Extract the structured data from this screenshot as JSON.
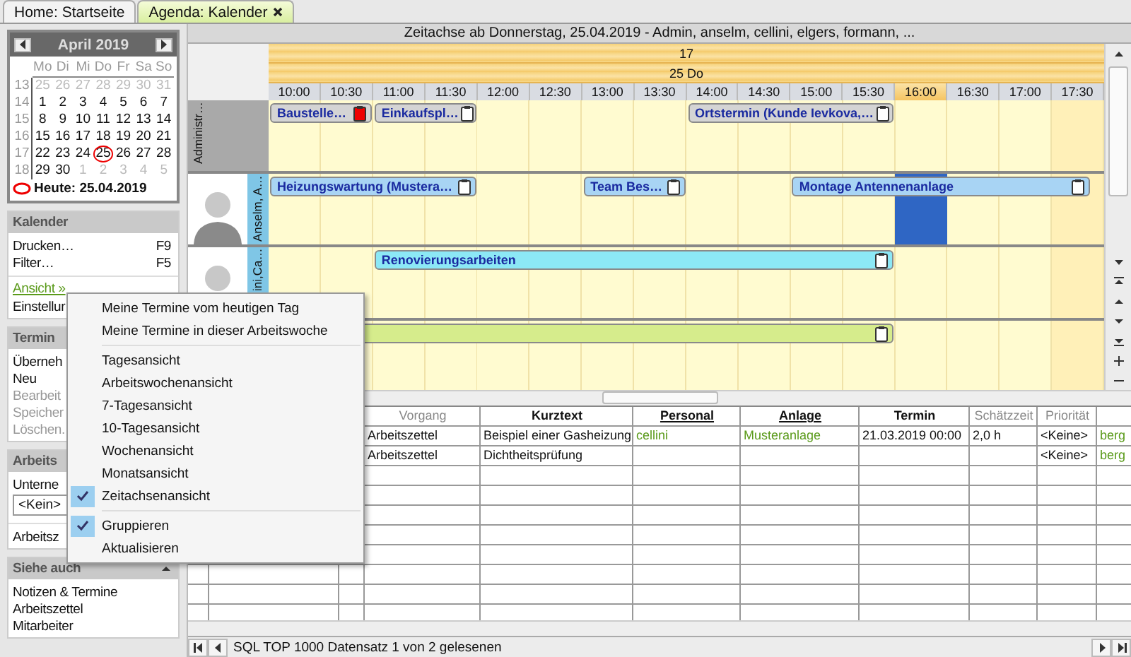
{
  "tabs": [
    {
      "label": "Home: Startseite",
      "selected": false,
      "closable": false
    },
    {
      "label": "Agenda: Kalender",
      "selected": true,
      "closable": true
    }
  ],
  "calendar": {
    "month": "April 2019",
    "weekdays": [
      "Mo",
      "Di",
      "Mi",
      "Do",
      "Fr",
      "Sa",
      "So"
    ],
    "weeks": [
      {
        "number": "13",
        "days": [
          {
            "label": "25",
            "muted": true,
            "today": false
          },
          {
            "label": "26",
            "muted": true,
            "today": false
          },
          {
            "label": "27",
            "muted": true,
            "today": false
          },
          {
            "label": "28",
            "muted": true,
            "today": false
          },
          {
            "label": "29",
            "muted": true,
            "today": false
          },
          {
            "label": "30",
            "muted": true,
            "today": false
          },
          {
            "label": "31",
            "muted": true,
            "today": false
          }
        ]
      },
      {
        "number": "14",
        "days": [
          {
            "label": "1",
            "muted": false,
            "today": false
          },
          {
            "label": "2",
            "muted": false,
            "today": false
          },
          {
            "label": "3",
            "muted": false,
            "today": false
          },
          {
            "label": "4",
            "muted": false,
            "today": false
          },
          {
            "label": "5",
            "muted": false,
            "today": false
          },
          {
            "label": "6",
            "muted": false,
            "today": false
          },
          {
            "label": "7",
            "muted": false,
            "today": false
          }
        ]
      },
      {
        "number": "15",
        "days": [
          {
            "label": "8",
            "muted": false,
            "today": false
          },
          {
            "label": "9",
            "muted": false,
            "today": false
          },
          {
            "label": "10",
            "muted": false,
            "today": false
          },
          {
            "label": "11",
            "muted": false,
            "today": false
          },
          {
            "label": "12",
            "muted": false,
            "today": false
          },
          {
            "label": "13",
            "muted": false,
            "today": false
          },
          {
            "label": "14",
            "muted": false,
            "today": false
          }
        ]
      },
      {
        "number": "16",
        "days": [
          {
            "label": "15",
            "muted": false,
            "today": false
          },
          {
            "label": "16",
            "muted": false,
            "today": false
          },
          {
            "label": "17",
            "muted": false,
            "today": false
          },
          {
            "label": "18",
            "muted": false,
            "today": false
          },
          {
            "label": "19",
            "muted": false,
            "today": false
          },
          {
            "label": "20",
            "muted": false,
            "today": false
          },
          {
            "label": "21",
            "muted": false,
            "today": false
          }
        ]
      },
      {
        "number": "17",
        "days": [
          {
            "label": "22",
            "muted": false,
            "today": false
          },
          {
            "label": "23",
            "muted": false,
            "today": false
          },
          {
            "label": "24",
            "muted": false,
            "today": false
          },
          {
            "label": "25",
            "muted": false,
            "today": true
          },
          {
            "label": "26",
            "muted": false,
            "today": false
          },
          {
            "label": "27",
            "muted": false,
            "today": false
          },
          {
            "label": "28",
            "muted": false,
            "today": false
          }
        ]
      },
      {
        "number": "18",
        "days": [
          {
            "label": "29",
            "muted": false,
            "today": false
          },
          {
            "label": "30",
            "muted": false,
            "today": false
          },
          {
            "label": "1",
            "muted": true,
            "today": false
          },
          {
            "label": "2",
            "muted": true,
            "today": false
          },
          {
            "label": "3",
            "muted": true,
            "today": false
          },
          {
            "label": "4",
            "muted": true,
            "today": false
          },
          {
            "label": "5",
            "muted": true,
            "today": false
          }
        ]
      }
    ],
    "today_label": "Heute: 25.04.2019"
  },
  "sidebar": [
    {
      "title": "Kalender",
      "collapsible": false,
      "items": [
        {
          "kind": "command",
          "label": "Drucken…",
          "shortcut": "F9"
        },
        {
          "kind": "command",
          "label": "Filter…",
          "shortcut": "F5"
        },
        {
          "kind": "separator"
        },
        {
          "kind": "link",
          "label": "Ansicht »"
        },
        {
          "kind": "command",
          "label": "Einstellur"
        }
      ]
    },
    {
      "title": "Termin",
      "items": [
        {
          "kind": "command",
          "label": "Überneh",
          "disabled": false
        },
        {
          "kind": "command",
          "label": "Neu",
          "disabled": false
        },
        {
          "kind": "command",
          "label": "Bearbeit",
          "disabled": true
        },
        {
          "kind": "command",
          "label": "Speicher",
          "disabled": true
        },
        {
          "kind": "command",
          "label": "Löschen.",
          "disabled": true
        }
      ]
    },
    {
      "title": "Arbeits",
      "items": [
        {
          "kind": "command",
          "label": "Unterne"
        },
        {
          "kind": "field",
          "label": "<Kein>"
        },
        {
          "kind": "separator"
        },
        {
          "kind": "command",
          "label": "Arbeitsz"
        }
      ]
    },
    {
      "title": "Siehe auch",
      "collapsible": true,
      "items": [
        {
          "kind": "command",
          "label": "Notizen & Termine"
        },
        {
          "kind": "command",
          "label": "Arbeitszettel"
        },
        {
          "kind": "command",
          "label": "Mitarbeiter"
        }
      ]
    }
  ],
  "timeline": {
    "title": "Zeitachse ab Donnerstag, 25.04.2019 - Admin, anselm, cellini, elgers, formann, ...",
    "week": "17",
    "day": "25 Do",
    "times": [
      {
        "label": "10:00",
        "current": false
      },
      {
        "label": "10:30",
        "current": false
      },
      {
        "label": "11:00",
        "current": false
      },
      {
        "label": "11:30",
        "current": false
      },
      {
        "label": "12:00",
        "current": false
      },
      {
        "label": "12:30",
        "current": false
      },
      {
        "label": "13:00",
        "current": false
      },
      {
        "label": "13:30",
        "current": false
      },
      {
        "label": "14:00",
        "current": false
      },
      {
        "label": "14:30",
        "current": false
      },
      {
        "label": "15:00",
        "current": false
      },
      {
        "label": "15:30",
        "current": false
      },
      {
        "label": "16:00",
        "current": true
      },
      {
        "label": "16:30",
        "current": false
      },
      {
        "label": "17:00",
        "current": false
      },
      {
        "label": "17:30",
        "current": false
      }
    ],
    "resources": [
      {
        "name": "Administr…",
        "photo": false,
        "selected": false,
        "events": [
          {
            "label": "Baustelle…",
            "color": "#d4d4d4",
            "flagged": true
          },
          {
            "label": "Einkaufspl…",
            "color": "#d4d4d4",
            "flagged": false
          },
          {
            "label": "Ortstermin (Kunde Ievkova,…",
            "color": "#d4d4d4",
            "flagged": false
          }
        ]
      },
      {
        "name": "Anselm, A…",
        "photo": true,
        "selected": true,
        "events": [
          {
            "label": "Heizungswartung (Mustera…",
            "color": "#a8d4f4",
            "flagged": false
          },
          {
            "label": "Team Bes…",
            "color": "#a8d4f4",
            "flagged": false
          },
          {
            "label": "Montage Antennenanlage",
            "color": "#a8d4f4",
            "flagged": false
          }
        ]
      },
      {
        "name": "ini,Ca…",
        "photo": true,
        "selected": false,
        "events": [
          {
            "label": "Renovierungsarbeiten",
            "color": "#8ce8f6",
            "flagged": false
          }
        ]
      },
      {
        "events": [
          {
            "color": "#d6ec8c",
            "flagged": false
          }
        ]
      }
    ]
  },
  "grid": {
    "columns": [
      {
        "label": "Vorgang",
        "kind": "muted"
      },
      {
        "label": "Kurztext",
        "kind": "bold"
      },
      {
        "label": "Personal",
        "kind": "link"
      },
      {
        "label": "Anlage",
        "kind": "link"
      },
      {
        "label": "Termin",
        "kind": "bold"
      },
      {
        "label": "Schätzzeit",
        "kind": "muted"
      },
      {
        "label": "Priorität",
        "kind": "muted"
      },
      {
        "kind": "link"
      }
    ],
    "rows": [
      {
        "cells": [
          "Arbeitszettel",
          "Beispiel einer Gasheizung",
          "cellini",
          "Musteranlage",
          "21.03.2019 00:00",
          "2,0 h",
          "<Keine>",
          "berg"
        ]
      },
      {
        "cells": [
          "Arbeitszettel",
          "Dichtheitsprüfung",
          "",
          "",
          "",
          "",
          "<Keine>",
          "berg"
        ]
      }
    ]
  },
  "status_bar": "SQL TOP 1000 Datensatz 1 von 2 gelesenen",
  "context_menu": [
    [
      {
        "label": "Meine Termine vom heutigen Tag",
        "checked": false
      },
      {
        "label": "Meine Termine in dieser Arbeitswoche",
        "checked": false
      }
    ],
    [
      {
        "label": "Tagesansicht",
        "checked": false
      },
      {
        "label": "Arbeitswochenansicht",
        "checked": false
      },
      {
        "label": "7-Tagesansicht",
        "checked": false
      },
      {
        "label": "10-Tagesansicht",
        "checked": false
      },
      {
        "label": "Wochenansicht",
        "checked": false
      },
      {
        "label": "Monatsansicht",
        "checked": false
      },
      {
        "label": "Zeitachsenansicht",
        "checked": true
      }
    ],
    [
      {
        "label": "Gruppieren",
        "checked": true
      },
      {
        "label": "Aktualisieren",
        "checked": false
      }
    ]
  ]
}
